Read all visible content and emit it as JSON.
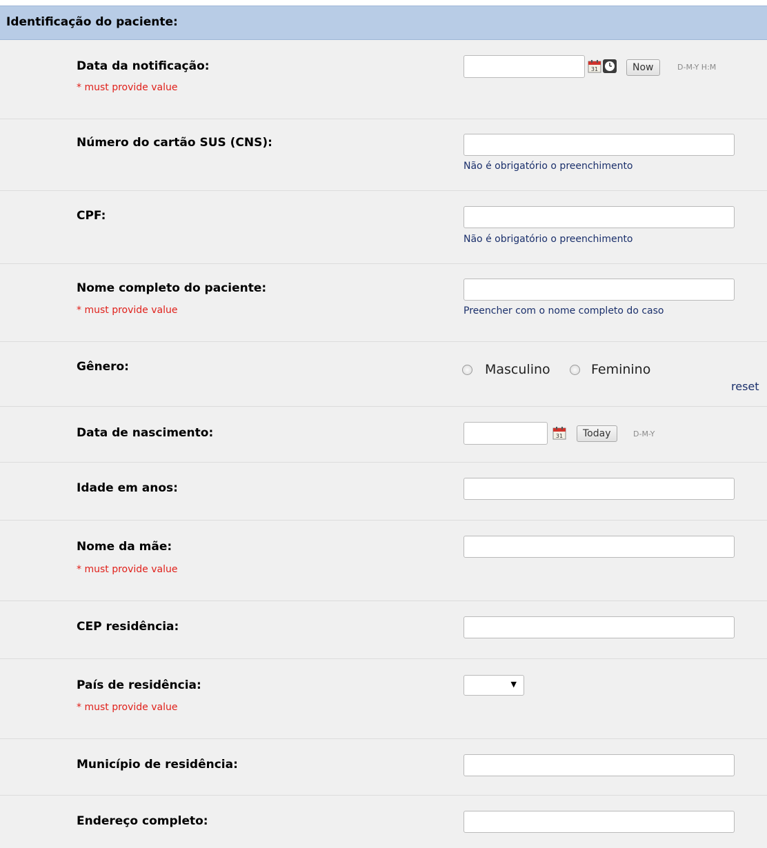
{
  "section": {
    "title": "Identificação do paciente:"
  },
  "fields": {
    "data_notificacao": {
      "label": "Data da notificação:",
      "required_text": "* must provide value",
      "value": "",
      "now_button": "Now",
      "format": "D-M-Y H:M"
    },
    "cns": {
      "label": "Número do cartão SUS (CNS):",
      "value": "",
      "note": "Não é obrigatório o preenchimento"
    },
    "cpf": {
      "label": "CPF:",
      "value": "",
      "note": "Não é obrigatório o preenchimento"
    },
    "nome_paciente": {
      "label": "Nome completo do paciente:",
      "required_text": "* must provide value",
      "value": "",
      "note": "Preencher com o nome completo do caso"
    },
    "genero": {
      "label": "Gênero:",
      "options": [
        "Masculino",
        "Feminino"
      ],
      "selected": null,
      "reset_label": "reset"
    },
    "data_nascimento": {
      "label": "Data de nascimento:",
      "value": "",
      "today_button": "Today",
      "format": "D-M-Y"
    },
    "idade": {
      "label": "Idade em anos:",
      "value": ""
    },
    "nome_mae": {
      "label": "Nome da mãe:",
      "required_text": "* must provide value",
      "value": ""
    },
    "cep": {
      "label": "CEP residência:",
      "value": ""
    },
    "pais": {
      "label": "País de residência:",
      "required_text": "* must provide value",
      "selected_value": ""
    },
    "municipio": {
      "label": "Município de residência:",
      "value": ""
    },
    "endereco": {
      "label": "Endereço completo:",
      "value": ""
    }
  },
  "icons": {
    "calendar": "calendar-icon",
    "clock": "clock-icon",
    "dropdown": "chevron-down-icon"
  },
  "colors": {
    "header_bg": "#b8cce6",
    "row_bg": "#f0f0f0",
    "required": "#e0201a",
    "note": "#1a2f6b"
  }
}
